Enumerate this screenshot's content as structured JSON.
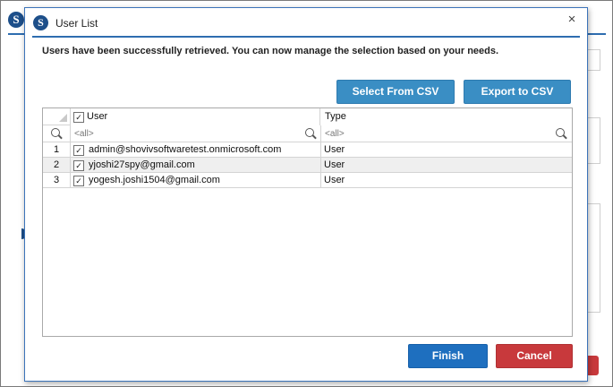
{
  "background": {
    "logo_letter": "S"
  },
  "dialog": {
    "logo_letter": "S",
    "title": "User List",
    "close_glyph": "×",
    "message": "Users have been successfully retrieved. You can now manage the selection based on your needs.",
    "buttons": {
      "select_csv": "Select From CSV",
      "export_csv": "Export to CSV",
      "finish": "Finish",
      "cancel": "Cancel"
    },
    "grid": {
      "columns": {
        "user": "User",
        "type": "Type"
      },
      "header_checked": true,
      "filter_placeholder": "<all>",
      "rows": [
        {
          "num": "1",
          "checked": true,
          "user": "admin@shovivsoftwaretest.onmicrosoft.com",
          "type": "User"
        },
        {
          "num": "2",
          "checked": true,
          "user": "yjoshi27spy@gmail.com",
          "type": "User"
        },
        {
          "num": "3",
          "checked": true,
          "user": "yogesh.joshi1504@gmail.com",
          "type": "User"
        }
      ]
    }
  },
  "colors": {
    "accent": "#3a8ec4",
    "primary": "#1e6fbf",
    "danger": "#c8393c"
  }
}
